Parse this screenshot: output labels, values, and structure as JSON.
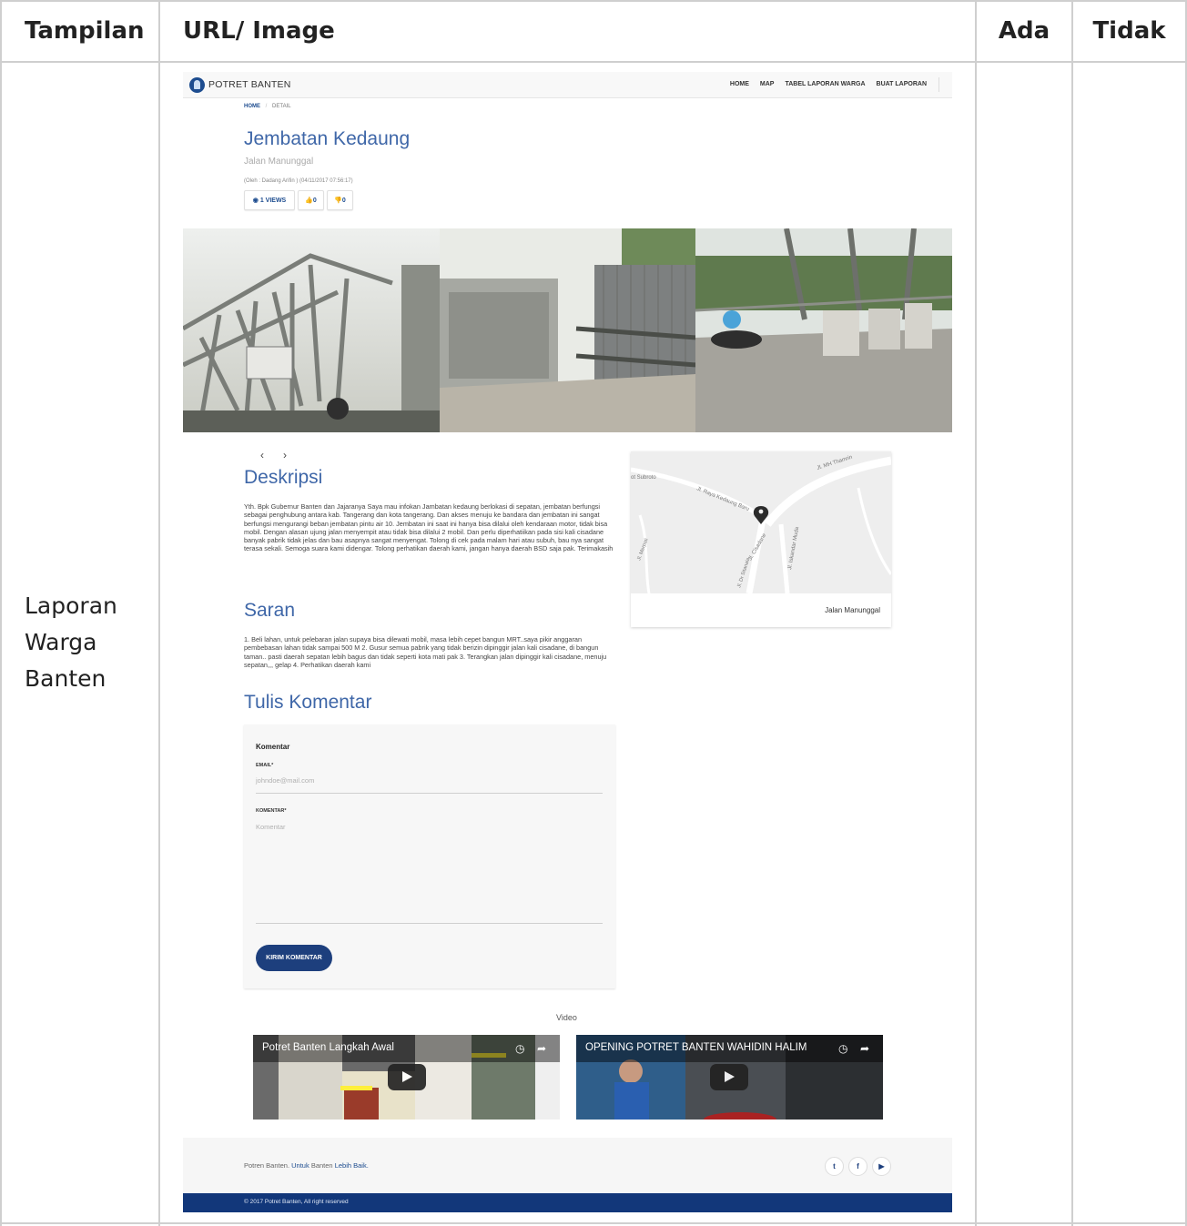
{
  "table": {
    "headers": [
      "Tampilan",
      "URL/ Image",
      "Ada",
      "Tidak"
    ],
    "row_label": [
      "Laporan",
      "Warga",
      "Banten"
    ]
  },
  "site": {
    "brand": "POTRET BANTEN",
    "nav": [
      "HOME",
      "MAP",
      "TABEL LAPORAN WARGA",
      "BUAT LAPORAN"
    ],
    "breadcrumb_home": "HOME",
    "breadcrumb_sep": "/",
    "breadcrumb_current": "DETAIL",
    "title": "Jembatan Kedaung",
    "subtitle": "Jalan Manunggal",
    "meta": "(Oleh : Dadang Arifin ) (04/11/2017 07:56:17)",
    "views_label": "◉ 1 VIEWS",
    "likes_label": "👍0",
    "dislikes_label": "👎0",
    "carousel_prev": "‹",
    "carousel_next": "›",
    "deskripsi_heading": "Deskripsi",
    "deskripsi_text": "Yth. Bpk Gubernur Banten dan Jajaranya Saya mau infokan Jambatan kedaung berlokasi di sepatan, jembatan berfungsi sebagai penghubung antara kab. Tangerang dan kota tangerang. Dan akses menuju ke bandara dan jembatan ini sangat berfungsi mengurangi beban jembatan pintu air 10. Jembatan ini saat ini hanya bisa dilalui oleh kendaraan motor, tidak bisa mobil. Dengan alasan ujung jalan menyempit atau tidak bisa dilalui 2 mobil. Dan perlu diperhatiikan pada sisi kali cisadane banyak pabrik tidak jelas dan bau asapnya sangat menyengat. Tolong di cek pada malam hari atau subuh, bau nya sangat terasa sekali. Semoga suara kami didengar. Tolong perhatikan daerah kami, jangan hanya daerah BSD saja pak. Terimakasih",
    "saran_heading": "Saran",
    "saran_text": "1. Beli lahan, untuk pelebaran jalan supaya bisa dilewati mobil, masa lebih cepet bangun MRT..saya pikir anggaran pembebasan lahan tidak sampai 500 M 2. Gusur semua pabrik yang tidak berizin dipinggir jalan kali cisadane, di bangun taman.. pasti daerah sepatan lebih bagus dan tidak seperti kota mati pak 3. Terangkan jalan dipinggir kali cisadane, menuju sepatan,,, gelap 4. Perhatikan daerah kami",
    "komentar_heading": "Tulis Komentar",
    "map": {
      "labels": [
        "Jl. MH Thamrin",
        "Jl. Raya Kedaung Baru",
        "ot Subroto",
        "Jl. Iskandar Muda",
        "Jl. Cisadane",
        "Jl. Merpati",
        "Jl. Dr Sitanala"
      ],
      "caption": "Jalan Manunggal"
    },
    "form": {
      "title": "Komentar",
      "email_label": "EMAIL*",
      "email_placeholder": "johndoe@mail.com",
      "komentar_label": "KOMENTAR*",
      "komentar_placeholder": "Komentar",
      "submit": "KIRIM KOMENTAR"
    },
    "video_label": "Video",
    "videos": [
      {
        "title": "Potret Banten Langkah Awal"
      },
      {
        "title": "OPENING POTRET BANTEN WAHIDIN HALIM"
      }
    ],
    "footer_a": "Potren Banten.",
    "footer_b": "Untuk",
    "footer_c": "Banten",
    "footer_d": "Lebih Baik.",
    "social": [
      "twitter-icon",
      "facebook-icon",
      "youtube-icon"
    ],
    "copyright": "© 2017 Potret Banten, All right reserved"
  }
}
